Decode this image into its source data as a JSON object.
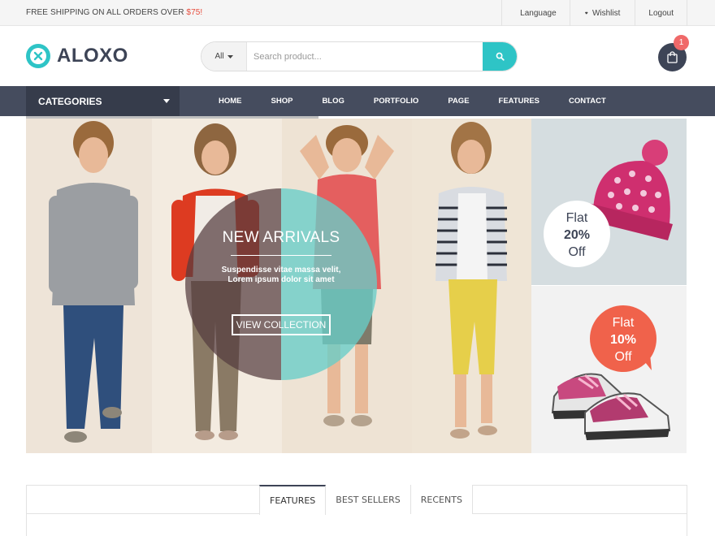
{
  "topbar": {
    "shipping_text": "FREE SHIPPING ON ALL ORDERS OVER ",
    "shipping_amount": "$75!",
    "language_label": "Language",
    "wishlist_label": "Wishlist",
    "logout_label": "Logout"
  },
  "header": {
    "logo_text": "ALOXO",
    "search_category": "All",
    "search_placeholder": "Search product...",
    "cart_count": "1"
  },
  "nav": {
    "categories_label": "CATEGORIES",
    "items": [
      "HOME",
      "SHOP",
      "BLOG",
      "PORTFOLIO",
      "PAGE",
      "FEATURES",
      "CONTACT"
    ]
  },
  "hero": {
    "title": "NEW ARRIVALS",
    "subtitle": "Suspendisse vitae massa velit, Lorem ipsum dolor sit amet",
    "button_label": "VIEW COLLECTION"
  },
  "promos": [
    {
      "line1": "Flat",
      "line2": "20%",
      "line3": "Off"
    },
    {
      "line1": "Flat",
      "line2": "10%",
      "line3": "Off"
    }
  ],
  "tabs": [
    "FEATURES",
    "BEST SELLERS",
    "RECENTS"
  ],
  "colors": {
    "accent": "#2ec4c6",
    "dark": "#3d4456",
    "nav": "#454c5e",
    "sale": "#f0624b"
  },
  "icons": {
    "language": "gear-icon",
    "wishlist": "heart-icon",
    "search": "search-icon",
    "cart": "shopping-bag-icon",
    "dropdown": "caret-down-icon"
  }
}
